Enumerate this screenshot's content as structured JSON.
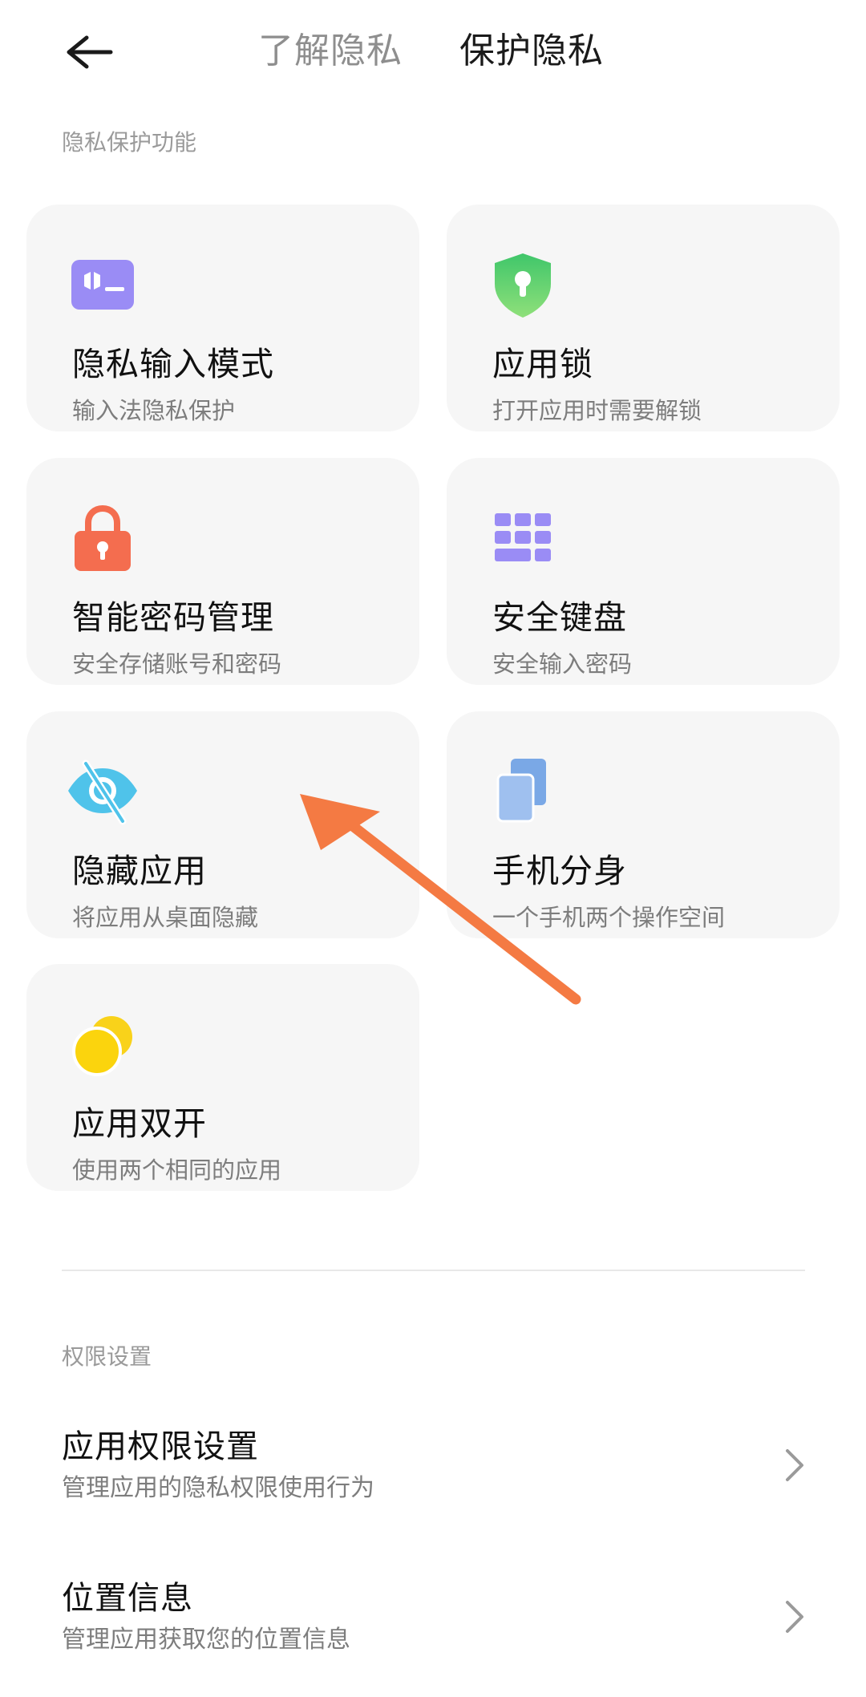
{
  "header": {
    "back_icon": "arrow-left-icon",
    "tabs": [
      {
        "label": "了解隐私",
        "active": false
      },
      {
        "label": "保护隐私",
        "active": true
      }
    ]
  },
  "privacy_features": {
    "section_label": "隐私保护功能",
    "cards": [
      {
        "title": "隐私输入模式",
        "subtitle": "输入法隐私保护",
        "icon": "private-keyboard-icon",
        "color": "#9a8cf5"
      },
      {
        "title": "应用锁",
        "subtitle": "打开应用时需要解锁",
        "icon": "shield-lock-icon",
        "color": "#6bd37a"
      },
      {
        "title": "智能密码管理",
        "subtitle": "安全存储账号和密码",
        "icon": "padlock-icon",
        "color": "#f46d4f"
      },
      {
        "title": "安全键盘",
        "subtitle": "安全输入密码",
        "icon": "keyboard-grid-icon",
        "color": "#9a8cf5"
      },
      {
        "title": "隐藏应用",
        "subtitle": "将应用从桌面隐藏",
        "icon": "eye-hidden-icon",
        "color": "#4fc3ea"
      },
      {
        "title": "手机分身",
        "subtitle": "一个手机两个操作空间",
        "icon": "dual-space-icon",
        "color": "#7aa8e6"
      },
      {
        "title": "应用双开",
        "subtitle": "使用两个相同的应用",
        "icon": "dual-apps-icon",
        "color": "#f9d21a"
      }
    ]
  },
  "permissions": {
    "section_label": "权限设置",
    "items": [
      {
        "title": "应用权限设置",
        "subtitle": "管理应用的隐私权限使用行为"
      },
      {
        "title": "位置信息",
        "subtitle": "管理应用获取您的位置信息"
      }
    ]
  },
  "annotation": {
    "color": "#f47a43"
  }
}
